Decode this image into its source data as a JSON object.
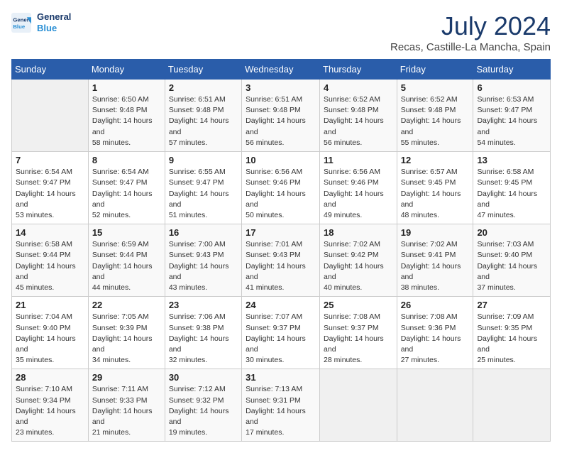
{
  "header": {
    "logo_line1": "General",
    "logo_line2": "Blue",
    "month_title": "July 2024",
    "subtitle": "Recas, Castille-La Mancha, Spain"
  },
  "weekdays": [
    "Sunday",
    "Monday",
    "Tuesday",
    "Wednesday",
    "Thursday",
    "Friday",
    "Saturday"
  ],
  "weeks": [
    [
      {
        "day": "",
        "sunrise": "",
        "sunset": "",
        "daylight": ""
      },
      {
        "day": "1",
        "sunrise": "6:50 AM",
        "sunset": "9:48 PM",
        "daylight": "14 hours and 58 minutes."
      },
      {
        "day": "2",
        "sunrise": "6:51 AM",
        "sunset": "9:48 PM",
        "daylight": "14 hours and 57 minutes."
      },
      {
        "day": "3",
        "sunrise": "6:51 AM",
        "sunset": "9:48 PM",
        "daylight": "14 hours and 56 minutes."
      },
      {
        "day": "4",
        "sunrise": "6:52 AM",
        "sunset": "9:48 PM",
        "daylight": "14 hours and 56 minutes."
      },
      {
        "day": "5",
        "sunrise": "6:52 AM",
        "sunset": "9:48 PM",
        "daylight": "14 hours and 55 minutes."
      },
      {
        "day": "6",
        "sunrise": "6:53 AM",
        "sunset": "9:47 PM",
        "daylight": "14 hours and 54 minutes."
      }
    ],
    [
      {
        "day": "7",
        "sunrise": "6:54 AM",
        "sunset": "9:47 PM",
        "daylight": "14 hours and 53 minutes."
      },
      {
        "day": "8",
        "sunrise": "6:54 AM",
        "sunset": "9:47 PM",
        "daylight": "14 hours and 52 minutes."
      },
      {
        "day": "9",
        "sunrise": "6:55 AM",
        "sunset": "9:47 PM",
        "daylight": "14 hours and 51 minutes."
      },
      {
        "day": "10",
        "sunrise": "6:56 AM",
        "sunset": "9:46 PM",
        "daylight": "14 hours and 50 minutes."
      },
      {
        "day": "11",
        "sunrise": "6:56 AM",
        "sunset": "9:46 PM",
        "daylight": "14 hours and 49 minutes."
      },
      {
        "day": "12",
        "sunrise": "6:57 AM",
        "sunset": "9:45 PM",
        "daylight": "14 hours and 48 minutes."
      },
      {
        "day": "13",
        "sunrise": "6:58 AM",
        "sunset": "9:45 PM",
        "daylight": "14 hours and 47 minutes."
      }
    ],
    [
      {
        "day": "14",
        "sunrise": "6:58 AM",
        "sunset": "9:44 PM",
        "daylight": "14 hours and 45 minutes."
      },
      {
        "day": "15",
        "sunrise": "6:59 AM",
        "sunset": "9:44 PM",
        "daylight": "14 hours and 44 minutes."
      },
      {
        "day": "16",
        "sunrise": "7:00 AM",
        "sunset": "9:43 PM",
        "daylight": "14 hours and 43 minutes."
      },
      {
        "day": "17",
        "sunrise": "7:01 AM",
        "sunset": "9:43 PM",
        "daylight": "14 hours and 41 minutes."
      },
      {
        "day": "18",
        "sunrise": "7:02 AM",
        "sunset": "9:42 PM",
        "daylight": "14 hours and 40 minutes."
      },
      {
        "day": "19",
        "sunrise": "7:02 AM",
        "sunset": "9:41 PM",
        "daylight": "14 hours and 38 minutes."
      },
      {
        "day": "20",
        "sunrise": "7:03 AM",
        "sunset": "9:40 PM",
        "daylight": "14 hours and 37 minutes."
      }
    ],
    [
      {
        "day": "21",
        "sunrise": "7:04 AM",
        "sunset": "9:40 PM",
        "daylight": "14 hours and 35 minutes."
      },
      {
        "day": "22",
        "sunrise": "7:05 AM",
        "sunset": "9:39 PM",
        "daylight": "14 hours and 34 minutes."
      },
      {
        "day": "23",
        "sunrise": "7:06 AM",
        "sunset": "9:38 PM",
        "daylight": "14 hours and 32 minutes."
      },
      {
        "day": "24",
        "sunrise": "7:07 AM",
        "sunset": "9:37 PM",
        "daylight": "14 hours and 30 minutes."
      },
      {
        "day": "25",
        "sunrise": "7:08 AM",
        "sunset": "9:37 PM",
        "daylight": "14 hours and 28 minutes."
      },
      {
        "day": "26",
        "sunrise": "7:08 AM",
        "sunset": "9:36 PM",
        "daylight": "14 hours and 27 minutes."
      },
      {
        "day": "27",
        "sunrise": "7:09 AM",
        "sunset": "9:35 PM",
        "daylight": "14 hours and 25 minutes."
      }
    ],
    [
      {
        "day": "28",
        "sunrise": "7:10 AM",
        "sunset": "9:34 PM",
        "daylight": "14 hours and 23 minutes."
      },
      {
        "day": "29",
        "sunrise": "7:11 AM",
        "sunset": "9:33 PM",
        "daylight": "14 hours and 21 minutes."
      },
      {
        "day": "30",
        "sunrise": "7:12 AM",
        "sunset": "9:32 PM",
        "daylight": "14 hours and 19 minutes."
      },
      {
        "day": "31",
        "sunrise": "7:13 AM",
        "sunset": "9:31 PM",
        "daylight": "14 hours and 17 minutes."
      },
      {
        "day": "",
        "sunrise": "",
        "sunset": "",
        "daylight": ""
      },
      {
        "day": "",
        "sunrise": "",
        "sunset": "",
        "daylight": ""
      },
      {
        "day": "",
        "sunrise": "",
        "sunset": "",
        "daylight": ""
      }
    ]
  ]
}
